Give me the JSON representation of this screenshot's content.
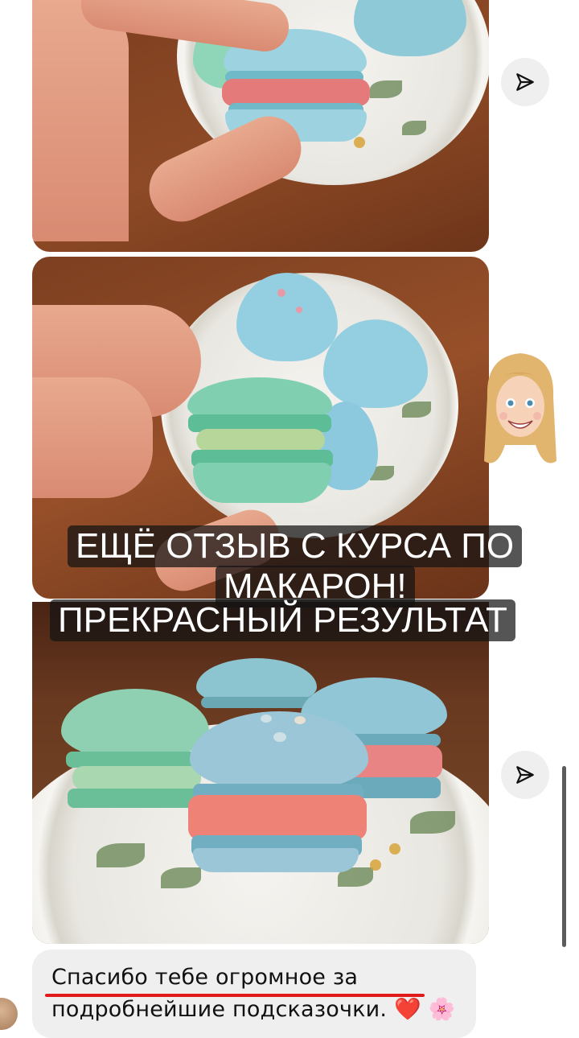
{
  "overlay": {
    "line1": "ЕЩЁ ОТЗЫВ С КУРСА ПО",
    "line2": "МАКАРОН!",
    "line3": "ПРЕКРАСНЫЙ РЕЗУЛЬТАТ"
  },
  "message": {
    "line1": "Спасибо тебе огромное за",
    "line2": "подробнейшие подсказочки.",
    "emoji_heart": "❤️",
    "emoji_flower": "🌸"
  },
  "icons": {
    "share": "paper-plane-icon",
    "avatar": "memoji-avatar"
  },
  "colors": {
    "bubble": "#efefef",
    "underline": "#e11b1b",
    "overlay_bg": "#141414"
  }
}
